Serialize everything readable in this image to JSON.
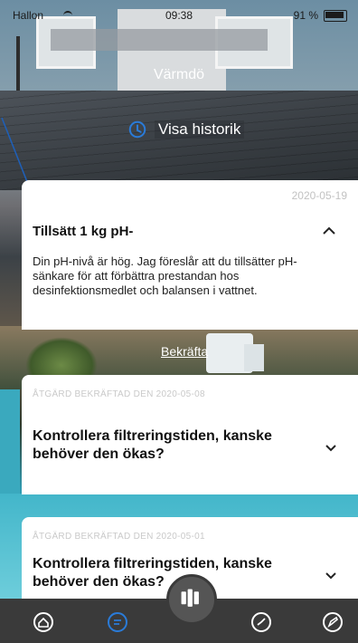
{
  "status_bar": {
    "carrier": "Hallon",
    "time": "09:38",
    "battery": "91 %"
  },
  "header": {
    "location": "Värmdö",
    "history_button": "Visa historik"
  },
  "cards": [
    {
      "date": "2020-05-19",
      "title": "Tillsätt  1 kg pH-",
      "body": "Din pH-nivå är hög. Jag föreslår att du tillsätter pH-sänkare för att förbättra prestandan hos desinfektionsmedlet och balansen i vattnet.",
      "confirm_label": "Bekräfta"
    },
    {
      "caption": "ÅTGÄRD BEKRÄFTAD DEN 2020-05-08",
      "title": "Kontrollera filtreringstiden, kanske behöver den ökas?"
    },
    {
      "caption": "ÅTGÄRD BEKRÄFTAD DEN 2020-05-01",
      "title": "Kontrollera filtreringstiden, kanske behöver den ökas?"
    }
  ],
  "nav": {
    "items": [
      "home-icon",
      "chat-icon",
      "pool-icon",
      "gauge-icon",
      "edit-icon"
    ]
  },
  "colors": {
    "nav_bg": "#3a3a3a",
    "card_bg": "#ffffff",
    "caption": "#c9c9c9",
    "arrow": "#1f5fb6"
  }
}
